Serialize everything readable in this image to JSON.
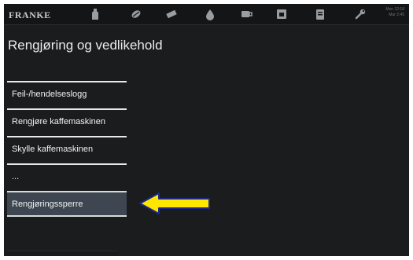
{
  "app": {
    "brand": "FRANKE"
  },
  "top_bar": {
    "icons": [
      "milk-bottle-icon",
      "bean-icon",
      "chocolate-icon",
      "water-drop-icon",
      "cup-icon",
      "coffee-machine-icon",
      "clipboard-icon",
      "wrench-icon"
    ],
    "status_line1": "Mon 12:18",
    "status_line2": "Mar 2:45"
  },
  "page": {
    "title": "Rengjøring og vedlikehold"
  },
  "menu": {
    "items": [
      {
        "label": "Feil-/hendelseslogg",
        "active": false
      },
      {
        "label": "Rengjøre kaffemaskinen",
        "active": false
      },
      {
        "label": "Skylle kaffemaskinen",
        "active": false
      },
      {
        "label": "...",
        "active": false
      },
      {
        "label": "Rengjøringssperre",
        "active": true
      }
    ]
  },
  "annotation": {
    "icon": "pointer-arrow-icon",
    "color": "#ffe600"
  },
  "colors": {
    "background": "#1a1c1e",
    "active_item": "#3d4651",
    "text": "#f2f2f2"
  }
}
